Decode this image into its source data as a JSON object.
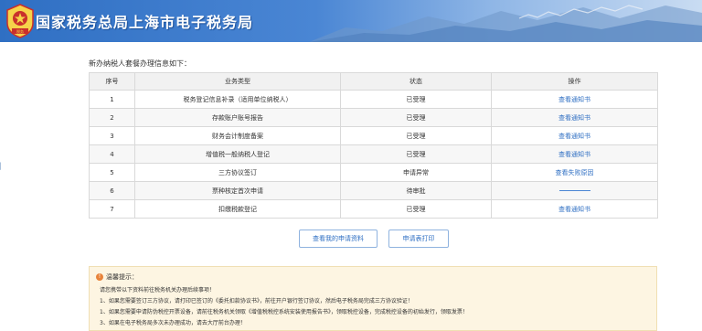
{
  "header": {
    "title": "国家税务总局上海市电子税务局",
    "logo_text": "税务"
  },
  "intro": "新办纳税人套餐办理信息如下：",
  "table": {
    "columns": [
      "序号",
      "业务类型",
      "状态",
      "操作"
    ],
    "rows": [
      {
        "no": "1",
        "type": "税务登记信息补录（适用单位纳税人）",
        "status": "已受理",
        "action": "查看通知书"
      },
      {
        "no": "2",
        "type": "存款账户账号报告",
        "status": "已受理",
        "action": "查看通知书"
      },
      {
        "no": "3",
        "type": "财务会计制度备案",
        "status": "已受理",
        "action": "查看通知书"
      },
      {
        "no": "4",
        "type": "增值税一般纳税人登记",
        "status": "已受理",
        "action": "查看通知书"
      },
      {
        "no": "5",
        "type": "三方协议签订",
        "status": "申请异常",
        "action": "查看失败原因"
      },
      {
        "no": "6",
        "type": "票种核定首次申请",
        "status": "待审批",
        "action": ""
      },
      {
        "no": "7",
        "type": "扣缴税款登记",
        "status": "已受理",
        "action": "查看通知书"
      }
    ]
  },
  "buttons": {
    "view_materials": "查看我的申请资料",
    "print_form": "申请表打印"
  },
  "tips": {
    "title": "温馨提示：",
    "lines": [
      "请您携带以下资料前往税务机关办理后续事项！",
      "1、如果您需要签订三方协议，请打印已签订的《委托扣款协议书》，前往开户银行签订协议，然后电子税务局完成三方协议验证！",
      "1、如果您需要申请防伪税控开票设备，请前往税务机关领取《增值税税控系统安装使用报告书》，领取税控设备，完成税控设备的初始发行，领取发票！",
      "3、如果在电子税务局多次未办理成功，请去大厅前台办理！"
    ]
  },
  "colors": {
    "header_blue": "#2f6fc3",
    "link_blue": "#2f6fc3",
    "tip_bg": "#fdf5e2",
    "tip_icon": "#e8833a"
  }
}
